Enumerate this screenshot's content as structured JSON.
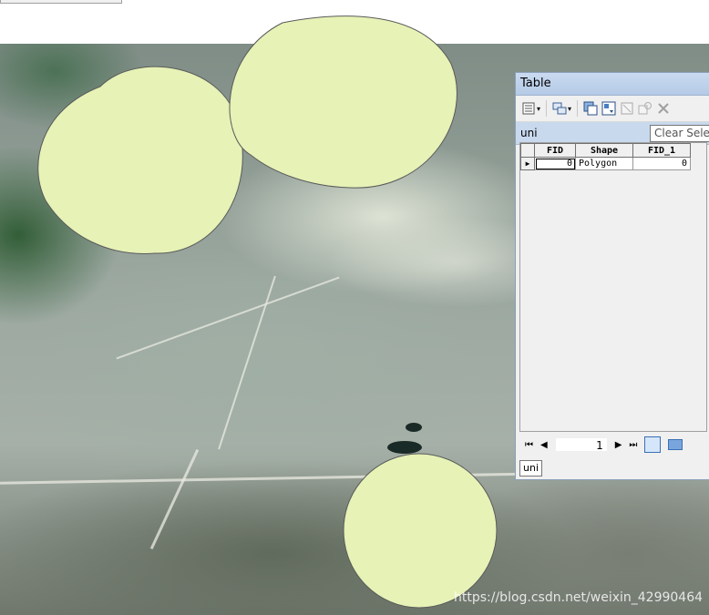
{
  "map": {
    "buffer_fill": "#e6f2b6",
    "buffer_stroke": "#5a5a5a",
    "watermark": "https://blog.csdn.net/weixin_42990464"
  },
  "table_window": {
    "title": "Table",
    "tab_label": "uni",
    "tooltip": "Clear Selection",
    "toolbar_icons": [
      "table-options-icon",
      "related-tables-icon",
      "select-by-attributes-icon",
      "switch-selection-icon",
      "clear-selection-icon",
      "zoom-to-selected-icon",
      "delete-selected-icon"
    ],
    "columns": [
      "FID",
      "Shape",
      "FID_1"
    ],
    "rows": [
      {
        "FID": "0",
        "Shape": "Polygon",
        "FID_1": "0"
      }
    ],
    "record_position": "1",
    "bottom_tab": "uni",
    "accent": "#c8d9ee"
  }
}
